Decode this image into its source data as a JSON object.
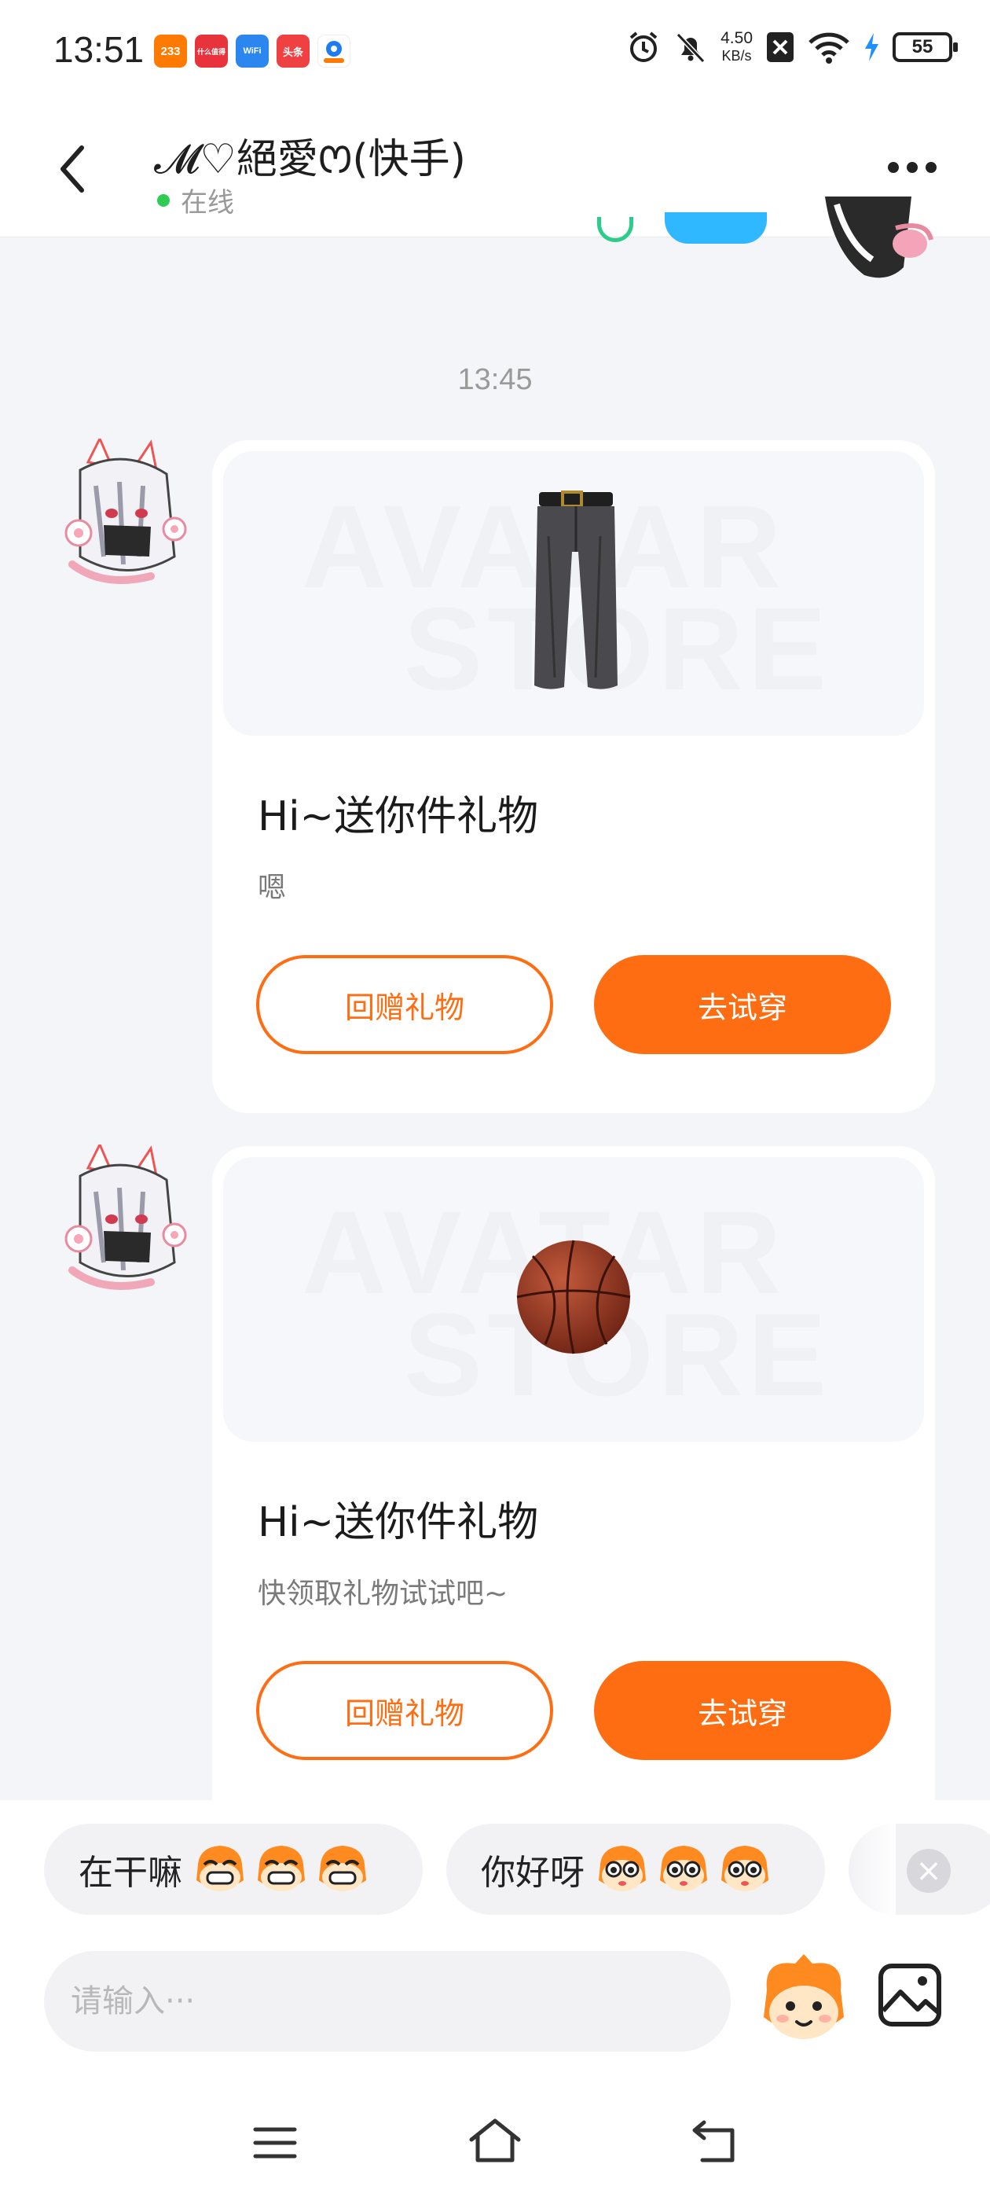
{
  "status_bar": {
    "time": "13:51",
    "notification_apps": [
      {
        "label": "233",
        "color": "#ff7a00"
      },
      {
        "label": "什么值得",
        "color": "#e8323c"
      },
      {
        "label": "WiFi",
        "color": "#2b86f0"
      },
      {
        "label": "头条",
        "color": "#f04142"
      },
      {
        "label": "",
        "color": "#ffffff"
      }
    ],
    "net_speed_value": "4.50",
    "net_speed_unit": "KB/s",
    "battery": "55"
  },
  "header": {
    "title": "𝓜♡絕愛ꯁ(快手)",
    "status": "在线"
  },
  "timestamp": "13:45",
  "messages": [
    {
      "image_icon": "pants-icon",
      "watermark_line1": "AVATAR",
      "watermark_line2": "STORE",
      "title": "Hi~送你件礼物",
      "subtitle": "嗯",
      "return_gift_label": "回赠礼物",
      "try_on_label": "去试穿"
    },
    {
      "image_icon": "basketball-icon",
      "watermark_line1": "AVATAR",
      "watermark_line2": "STORE",
      "title": "Hi~送你件礼物",
      "subtitle": "快领取礼物试试吧~",
      "return_gift_label": "回赠礼物",
      "try_on_label": "去试穿"
    }
  ],
  "quick_replies": [
    {
      "text": "在干嘛",
      "emoji": "grin-mascot-icon"
    },
    {
      "text": "你好呀",
      "emoji": "wide-eye-mascot-icon"
    }
  ],
  "input": {
    "placeholder": "请输入···"
  },
  "colors": {
    "accent": "#ff6d12",
    "online": "#2ecc52",
    "background": "#f4f5f9"
  }
}
